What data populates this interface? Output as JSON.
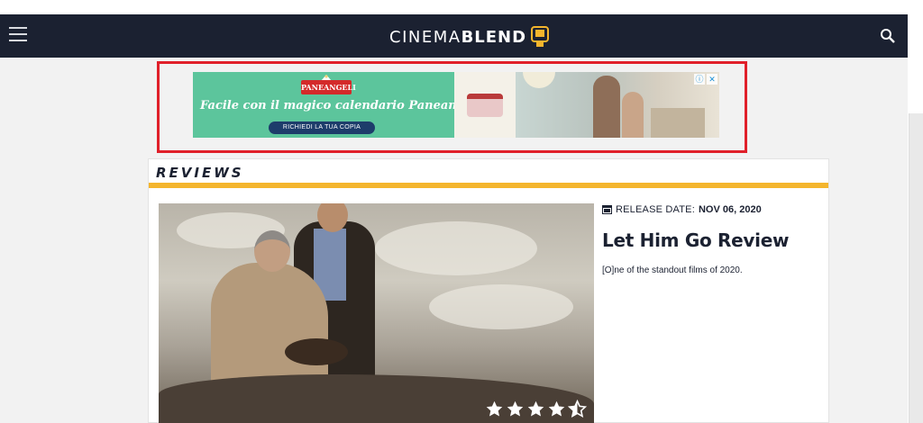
{
  "header": {
    "logo_light": "CINEMA",
    "logo_bold": "BLEND",
    "menu_icon": "hamburger-menu-icon",
    "search_icon": "search-icon",
    "background": "#1b2131"
  },
  "ad": {
    "brand": "PANEANGELI",
    "headline": "Facile con il magico calendario Paneangeli.",
    "cta": "RICHIEDI LA TUA COPIA",
    "info_icon": "ⓘ",
    "close_icon": "✕",
    "highlight_color": "#e0202a"
  },
  "reviews": {
    "heading": "REVIEWS",
    "accent_color": "#f4b52d",
    "item": {
      "release_label": "RELEASE DATE:",
      "release_date": "NOV 06, 2020",
      "title": "Let Him Go Review",
      "excerpt": "[O]ne of the standout films of 2020.",
      "rating": 4.5,
      "rating_max": 5
    }
  }
}
